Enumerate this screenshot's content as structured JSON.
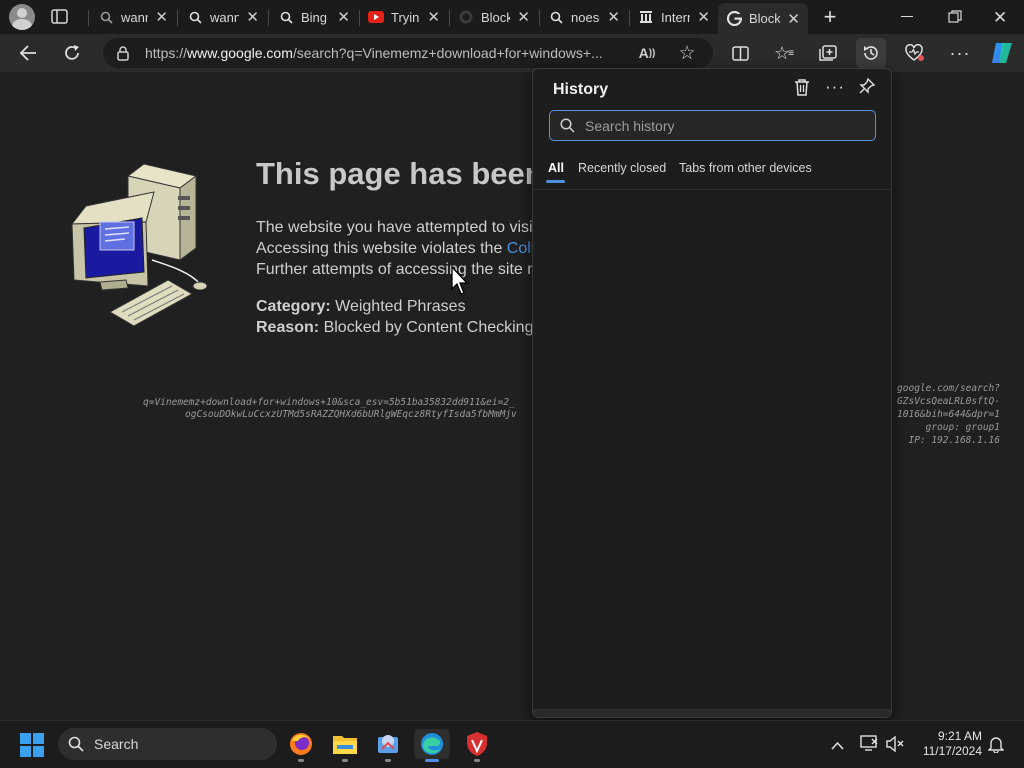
{
  "browser": {
    "tabs": [
      {
        "title": "wann",
        "icon": "search-icon",
        "active": false
      },
      {
        "title": "wann",
        "icon": "search-icon",
        "active": false
      },
      {
        "title": "Bing",
        "icon": "search-icon",
        "active": false
      },
      {
        "title": "Trying",
        "icon": "youtube-icon",
        "active": false
      },
      {
        "title": "Block",
        "icon": "github-icon",
        "active": false
      },
      {
        "title": "noesc",
        "icon": "search-icon",
        "active": false
      },
      {
        "title": "Intern",
        "icon": "archive-icon",
        "active": false
      },
      {
        "title": "Block",
        "icon": "google-icon",
        "active": true
      }
    ],
    "url_prefix": "https://",
    "url_host": "www.google.com",
    "url_path": "/search?q=Vinememz+download+for+windows+..."
  },
  "page": {
    "title": "This page has been",
    "line1": "The website you have attempted to visi",
    "line2_pre": "Accessing this website violates the ",
    "line2_link": "Coll",
    "line3": "Further attempts of accessing the site n",
    "category_label": "Category:",
    "category_value": " Weighted Phrases",
    "reason_label": "Reason:",
    "reason_value": " Blocked by Content Checking.",
    "url_left_1": "q=Vinememz+download+for+windows+10&sca_esv=5b51ba35832dd911&ei=2_",
    "url_left_2": "ogCsouDOkwLuCcxzUTMd5sRAZZQHXd6bURlgWEqcz8RtyfIsda5fbMmMjv",
    "url_right_1": "google.com/search?",
    "url_right_2": "GZsVcsQeaLRL0sftQ-",
    "url_right_3": "1016&bih=644&dpr=1",
    "group": "group: group1",
    "ip": "IP: 192.168.1.16"
  },
  "history_panel": {
    "title": "History",
    "search_placeholder": "Search history",
    "tabs": [
      "All",
      "Recently closed",
      "Tabs from other devices"
    ]
  },
  "taskbar": {
    "search_label": "Search",
    "time": "9:21 AM",
    "date": "11/17/2024"
  },
  "colors": {
    "accent": "#4e8fe0",
    "link": "#4e8fe0",
    "background": "#202020"
  }
}
